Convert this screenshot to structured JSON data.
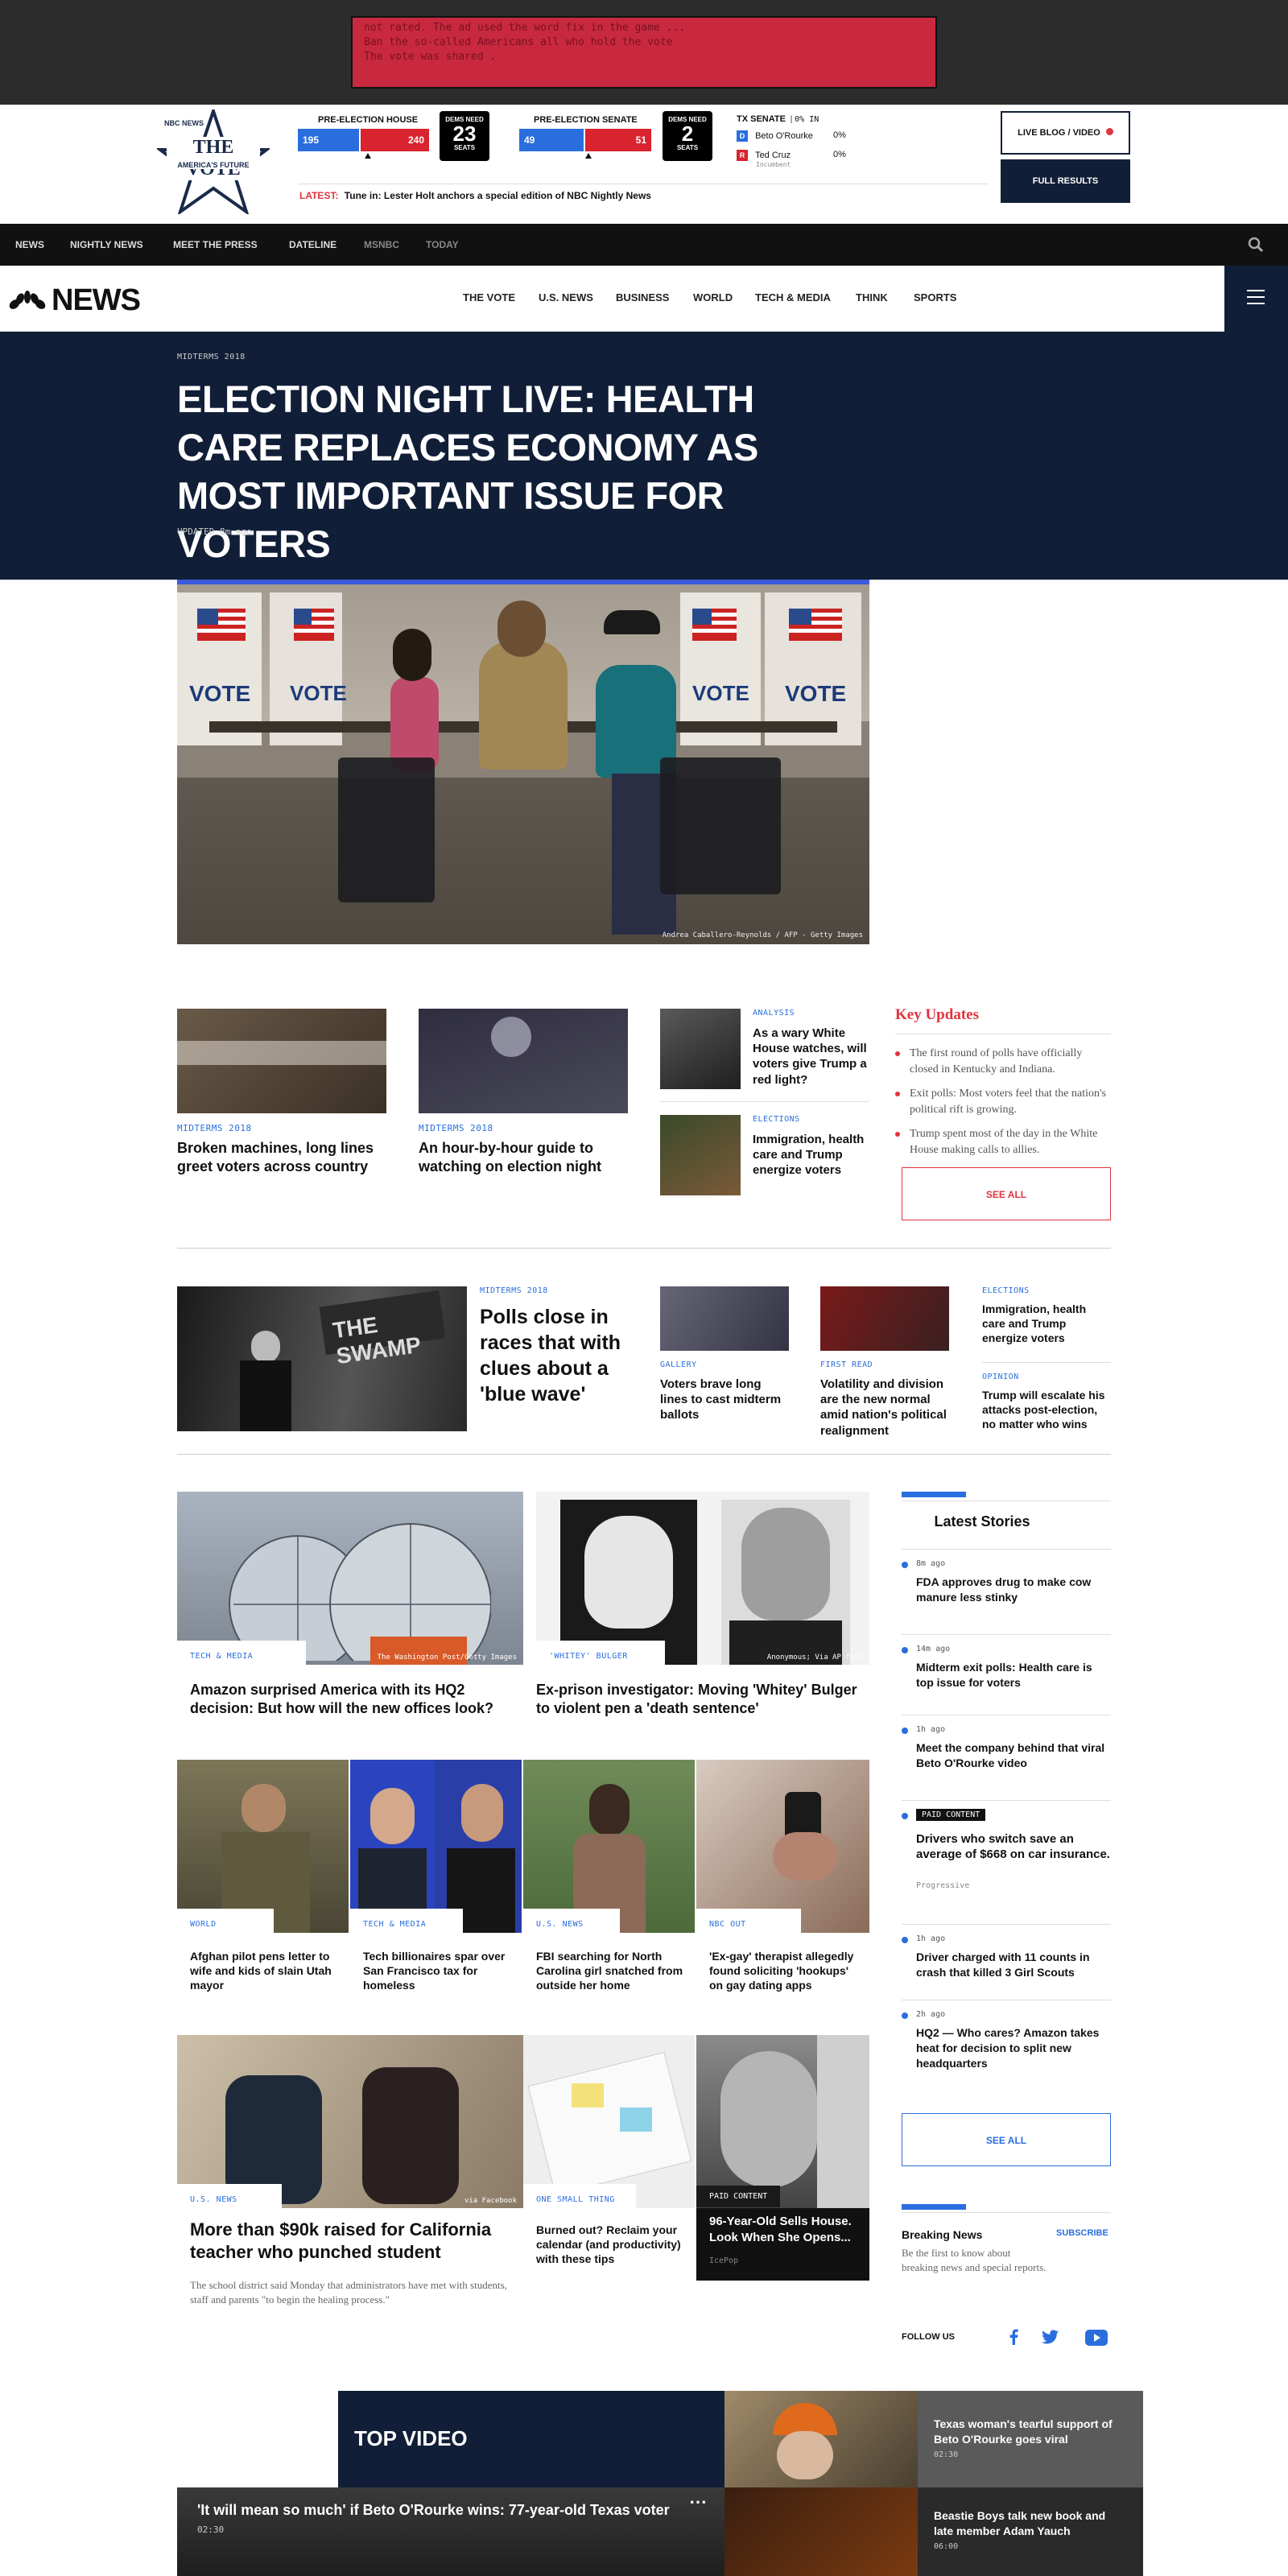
{
  "ad": {
    "lines": [
      "not rated. The ad used the word fix in the game ...",
      "Ban the so-called Americans all who hold the vote",
      "The vote was shared ."
    ]
  },
  "vote": {
    "network": "NBC NEWS",
    "title": "THE VOTE",
    "subtitle": "AMERICA'S FUTURE",
    "house": {
      "label": "PRE-ELECTION HOUSE",
      "dem": "195",
      "rep": "240",
      "need_label": "DEMS NEED",
      "need": "23",
      "seats": "SEATS"
    },
    "senate": {
      "label": "PRE-ELECTION SENATE",
      "dem": "49",
      "rep": "51",
      "need_label": "DEMS NEED",
      "need": "2",
      "seats": "SEATS"
    },
    "tx": {
      "label": "TX SENATE",
      "pct_in": "0% IN",
      "cands": [
        {
          "party": "D",
          "name": "Beto O'Rourke",
          "pct": "0%",
          "note": ""
        },
        {
          "party": "R",
          "name": "Ted Cruz",
          "pct": "0%",
          "note": "Incumbent"
        }
      ]
    },
    "live_btn": "LIVE BLOG / VIDEO",
    "results_btn": "FULL RESULTS",
    "latest_label": "LATEST:",
    "latest_text": "Tune in: Lester Holt anchors a special edition of NBC Nightly News"
  },
  "topnav": [
    "NEWS",
    "NIGHTLY NEWS",
    "MEET THE PRESS",
    "DATELINE",
    "MSNBC",
    "TODAY"
  ],
  "mainnav": {
    "logo": "NEWS",
    "items": [
      "THE VOTE",
      "U.S. NEWS",
      "BUSINESS",
      "WORLD",
      "TECH & MEDIA",
      "THINK",
      "SPORTS"
    ]
  },
  "hero": {
    "eyebrow": "MIDTERMS 2018",
    "headline": "ELECTION NIGHT LIVE: HEALTH CARE REPLACES ECONOMY AS MOST IMPORTANT ISSUE FOR VOTERS",
    "updated": "UPDATED 8m ago",
    "credit": "Andrea Caballero-Reynolds / AFP - Getty Images",
    "booth_text": "VOTE"
  },
  "row1": [
    {
      "eyebrow": "MIDTERMS 2018",
      "headline": "Broken machines, long lines greet voters across country"
    },
    {
      "eyebrow": "MIDTERMS 2018",
      "headline": "An hour-by-hour guide to watching on election night"
    }
  ],
  "row1_small": [
    {
      "eyebrow": "ANALYSIS",
      "headline": "As a wary White House watches, will voters give Trump a red light?"
    },
    {
      "eyebrow": "ELECTIONS",
      "headline": "Immigration, health care and Trump energize voters"
    }
  ],
  "key_updates": {
    "title": "Key Updates",
    "items": [
      "The first round of polls have officially closed in Kentucky and Indiana.",
      "Exit polls: Most voters feel that the nation's political rift is growing.",
      "Trump spent most of the day in the White House making calls to allies."
    ],
    "see_all": "SEE ALL"
  },
  "row2": {
    "eyebrow": "MIDTERMS 2018",
    "headline": "Polls close in races that with clues about a 'blue wave'",
    "sign": "THE SWAMP",
    "items": [
      {
        "eyebrow": "GALLERY",
        "headline": "Voters brave long lines to cast midterm ballots"
      },
      {
        "eyebrow": "FIRST READ",
        "headline": "Volatility and division are the new normal amid nation's political realignment"
      }
    ],
    "text_items": [
      {
        "eyebrow": "ELECTIONS",
        "headline": "Immigration, health care and Trump energize voters"
      },
      {
        "eyebrow": "OPINION",
        "headline": "Trump will escalate his attacks post-election, no matter who wins"
      }
    ]
  },
  "feature": [
    {
      "eyebrow": "TECH & MEDIA",
      "headline": "Amazon surprised America with its HQ2 decision: But how will the new offices look?",
      "credit": "The Washington Post/Getty Images"
    },
    {
      "eyebrow": "'WHITEY' BULGER",
      "headline": "Ex-prison investigator: Moving 'Whitey' Bulger to violent pen a 'death sentence'",
      "credit": "Anonymous; Via AP file"
    }
  ],
  "quad": [
    {
      "eyebrow": "WORLD",
      "headline": "Afghan pilot pens letter to wife and kids of slain Utah mayor"
    },
    {
      "eyebrow": "TECH & MEDIA",
      "headline": "Tech billionaires spar over San Francisco tax for homeless"
    },
    {
      "eyebrow": "U.S. NEWS",
      "headline": "FBI searching for North Carolina girl snatched from outside her home"
    },
    {
      "eyebrow": "NBC OUT",
      "headline": "'Ex-gay' therapist allegedly found soliciting 'hookups' on gay dating apps"
    }
  ],
  "bottom": {
    "main": {
      "eyebrow": "U.S. NEWS",
      "headline": "More than $90k raised for California teacher who punched student",
      "dek": "The school district said Monday that administrators have met with students, staff and parents \"to begin the healing process.\"",
      "credit": "via Facebook"
    },
    "mid": {
      "eyebrow": "ONE SMALL THING",
      "headline": "Burned out? Reclaim your calendar (and productivity) with these tips"
    },
    "paid": {
      "label": "PAID CONTENT",
      "headline": "96-Year-Old Sells House. Look When She Opens...",
      "sponsor": "IcePop"
    }
  },
  "latest": {
    "title": "Latest Stories",
    "items": [
      {
        "time": "8m ago",
        "headline": "FDA approves drug to make cow manure less stinky"
      },
      {
        "time": "14m ago",
        "headline": "Midterm exit polls: Health care is top issue for voters"
      },
      {
        "time": "1h ago",
        "headline": "Meet the company behind that viral Beto O'Rourke video"
      },
      {
        "time": "PAID CONTENT",
        "headline": "Drivers who switch save an average of $668 on car insurance.",
        "sponsor": "Progressive"
      },
      {
        "time": "1h ago",
        "headline": "Driver charged with 11 counts in crash that killed 3 Girl Scouts"
      },
      {
        "time": "2h ago",
        "headline": "HQ2 — Who cares? Amazon takes heat for decision to split new headquarters"
      }
    ],
    "see_all": "SEE ALL"
  },
  "breaking": {
    "title": "Breaking News",
    "subscribe": "SUBSCRIBE",
    "text": "Be the first to know about breaking news and special reports.",
    "follow": "FOLLOW US"
  },
  "top_video": {
    "title": "TOP VIDEO",
    "main": {
      "headline": "'It will mean so much' if Beto O'Rourke wins: 77-year-old Texas voter",
      "time": "02:30"
    },
    "side": [
      {
        "headline": "Texas woman's tearful support of Beto O'Rourke goes viral",
        "time": "02:30"
      },
      {
        "headline": "Beastie Boys talk new book and late member Adam Yauch",
        "time": "06:00"
      }
    ]
  },
  "colors": {
    "navy": "#111e37",
    "blue": "#2a6ede",
    "red": "#e0343e",
    "dem": "#2a6ede",
    "rep": "#d9232e"
  }
}
